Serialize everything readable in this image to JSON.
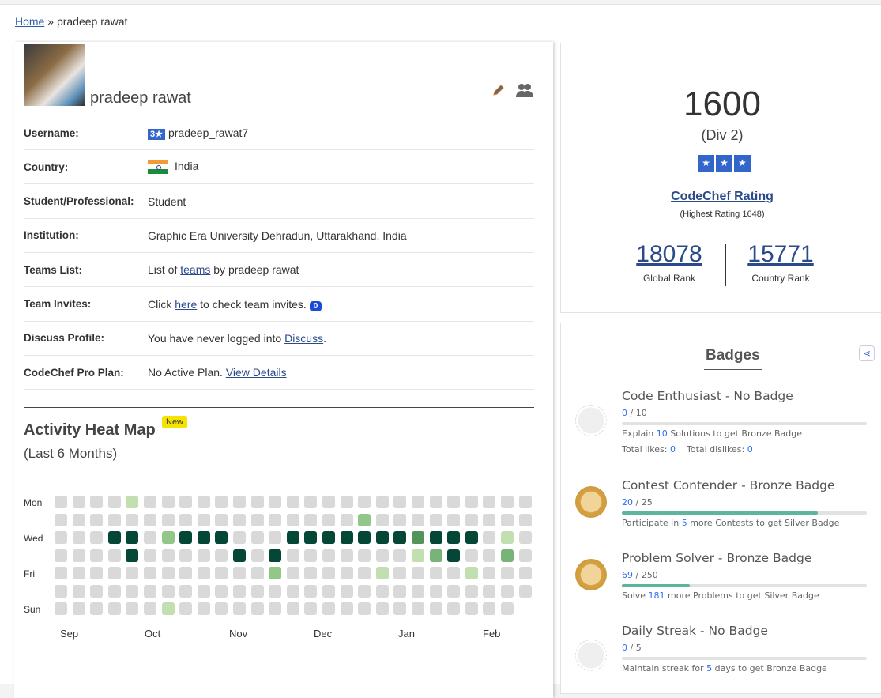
{
  "breadcrumb": {
    "home": "Home",
    "sep": "»",
    "current": "pradeep rawat"
  },
  "profile": {
    "name": "pradeep rawat",
    "rows": [
      {
        "label": "Username:",
        "star": "3★",
        "value": "pradeep_rawat7"
      },
      {
        "label": "Country:",
        "value": "India"
      },
      {
        "label": "Student/Professional:",
        "value": "Student"
      },
      {
        "label": "Institution:",
        "value": "Graphic Era University Dehradun, Uttarakhand, India"
      },
      {
        "label": "Teams List:",
        "pre": "List of ",
        "link": "teams",
        "post": " by pradeep rawat"
      },
      {
        "label": "Team Invites:",
        "pre": "Click ",
        "link": "here",
        "post": " to check team invites.",
        "count": "0"
      },
      {
        "label": "Discuss Profile:",
        "pre": "You have never logged into ",
        "link": "Discuss",
        "post": "."
      },
      {
        "label": "CodeChef Pro Plan:",
        "pre": "No Active Plan. ",
        "link": "View Details"
      }
    ]
  },
  "heatmap": {
    "title": "Activity Heat Map",
    "badge": "New",
    "subtitle": "(Last 6 Months)",
    "days": [
      "Mon",
      "Wed",
      "Fri",
      "Sun"
    ],
    "months": [
      "Sep",
      "Oct",
      "Nov",
      "Dec",
      "Jan",
      "Feb"
    ],
    "colors": [
      "#d9d9d9",
      "#c2dfb0",
      "#93c78a",
      "#78b378",
      "#53945a",
      "#054737"
    ],
    "levels": [
      [
        0,
        0,
        0,
        0,
        1,
        0,
        0,
        0,
        0,
        0,
        0,
        0,
        0,
        0,
        0,
        0,
        0,
        0,
        0,
        0,
        0,
        0,
        0,
        0,
        0,
        0,
        0
      ],
      [
        0,
        0,
        0,
        0,
        0,
        0,
        0,
        0,
        0,
        0,
        0,
        0,
        0,
        0,
        0,
        0,
        0,
        2,
        0,
        0,
        0,
        0,
        0,
        0,
        0,
        0,
        0
      ],
      [
        0,
        0,
        0,
        5,
        5,
        0,
        2,
        5,
        5,
        5,
        0,
        0,
        0,
        5,
        5,
        5,
        5,
        5,
        5,
        5,
        4,
        5,
        5,
        5,
        0,
        1,
        0
      ],
      [
        0,
        0,
        0,
        0,
        5,
        0,
        0,
        0,
        0,
        0,
        5,
        0,
        5,
        0,
        0,
        0,
        0,
        0,
        0,
        0,
        1,
        3,
        5,
        0,
        0,
        3,
        0
      ],
      [
        0,
        0,
        0,
        0,
        0,
        0,
        0,
        0,
        0,
        0,
        0,
        0,
        2,
        0,
        0,
        0,
        0,
        0,
        1,
        0,
        0,
        0,
        0,
        1,
        0,
        0,
        0
      ],
      [
        0,
        0,
        0,
        0,
        0,
        0,
        0,
        0,
        0,
        0,
        0,
        0,
        0,
        0,
        0,
        0,
        0,
        0,
        0,
        0,
        0,
        0,
        0,
        0,
        0,
        0,
        0
      ],
      [
        0,
        0,
        0,
        0,
        0,
        0,
        1,
        0,
        0,
        0,
        0,
        0,
        0,
        0,
        0,
        0,
        0,
        0,
        0,
        0,
        0,
        0,
        0,
        0,
        0,
        0,
        null
      ]
    ]
  },
  "rating": {
    "value": "1600",
    "division": "(Div 2)",
    "stars": "★",
    "label": "CodeChef Rating",
    "highest": "(Highest Rating 1648)",
    "global_rank": "18078",
    "global_label": "Global Rank",
    "country_rank": "15771",
    "country_label": "Country Rank"
  },
  "badges": {
    "title": "Badges",
    "items": [
      {
        "title": "Code Enthusiast - No Badge",
        "cur": "0",
        "total": " / 10",
        "progress": 0,
        "d1": "Explain ",
        "n": "10",
        "d2": " Solutions to get Bronze Badge",
        "likes_label": "Total likes: ",
        "likes": "0",
        "dislikes_label": "Total dislikes: ",
        "dislikes": "0"
      },
      {
        "title": "Contest Contender - Bronze Badge",
        "cur": "20",
        "total": " / 25",
        "progress": 0.8,
        "d1": "Participate in ",
        "n": "5",
        "d2": " more Contests to get Silver Badge"
      },
      {
        "title": "Problem Solver - Bronze Badge",
        "cur": "69",
        "total": " / 250",
        "progress": 0.276,
        "d1": "Solve ",
        "n": "181",
        "d2": " more Problems to get Silver Badge"
      },
      {
        "title": "Daily Streak - No Badge",
        "cur": "0",
        "total": " / 5",
        "progress": 0,
        "d1": "Maintain streak for ",
        "n": "5",
        "d2": " days to get Bronze Badge"
      }
    ]
  }
}
